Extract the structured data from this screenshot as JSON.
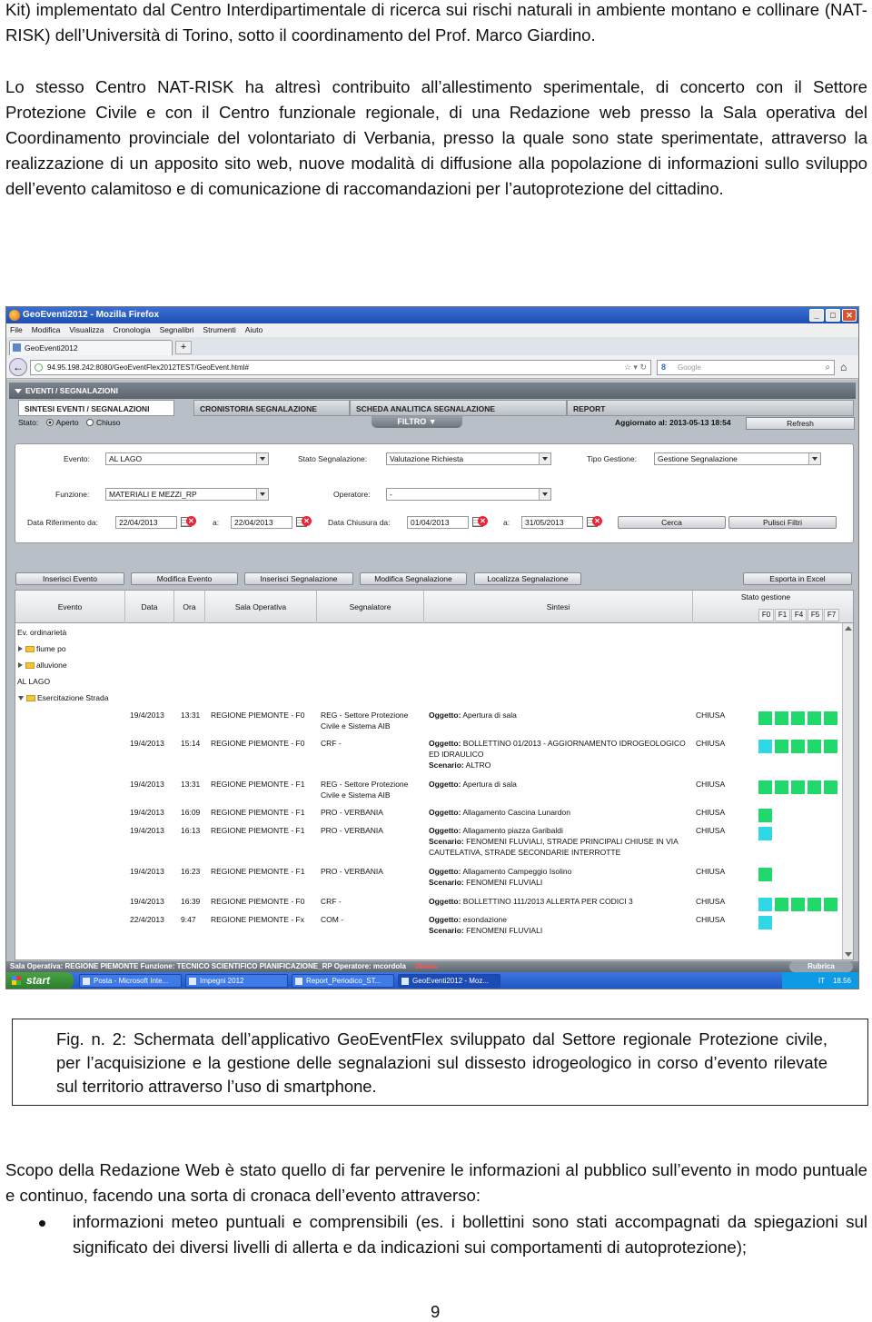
{
  "doc": {
    "para_top": "Kit) implementato dal Centro Interdipartimentale di ricerca sui rischi naturali in ambiente montano e collinare (NAT-RISK) dell’Università di Torino, sotto il coordinamento del Prof. Marco Giardino.",
    "para_2": "Lo stesso Centro NAT-RISK ha altresì contribuito all’allestimento sperimentale, di concerto con il Settore Protezione Civile e con il Centro funzionale regionale, di una Redazione web presso la Sala operativa del Coordinamento provinciale del volontariato di Verbania, presso la quale sono state sperimentate, attraverso la realizzazione di un apposito sito web, nuove modalità di diffusione alla popolazione di informazioni sullo sviluppo dell’evento calamitoso e di comunicazione di raccomandazioni per l’autoprotezione del cittadino.",
    "caption": "Fig. n. 2: Schermata dell’applicativo GeoEventFlex sviluppato dal Settore regionale Protezione civile, per l’acquisizione e la gestione delle segnalazioni sul dissesto idrogeologico in corso d’evento rilevate sul territorio attraverso l’uso di smartphone.",
    "para_3": "Scopo della Redazione Web è stato quello di far pervenire le informazioni al pubblico sull’evento in modo puntuale e continuo, facendo una sorta di cronaca dell’evento attraverso:",
    "bullet_1": "informazioni meteo puntuali e comprensibili (es. i bollettini sono stati accompagnati da spiegazioni sul significato dei diversi livelli di allerta e da indicazioni sui comportamenti di autoprotezione);",
    "page_number": "9"
  },
  "browser": {
    "title": "GeoEventi2012 - Mozilla Firefox",
    "menu": [
      "File",
      "Modifica",
      "Visualizza",
      "Cronologia",
      "Segnalibri",
      "Strumenti",
      "Aiuto"
    ],
    "tab_label": "GeoEventi2012",
    "new_tab": "+",
    "url": "94.95.198.242:8080/GeoEventFlex2012TEST/GeoEvent.html#",
    "search_placeholder": "Google",
    "search_logo": "8"
  },
  "app": {
    "section_title": "EVENTI / SEGNALAZIONI",
    "tabs": [
      "SINTESI EVENTI / SEGNALAZIONI",
      "CRONISTORIA SEGNALAZIONE",
      "SCHEDA ANALITICA SEGNALAZIONE",
      "REPORT"
    ],
    "stato_label": "Stato:",
    "stato_options": [
      "Aperto",
      "Chiuso"
    ],
    "filtro_label": "FILTRO ▼",
    "aggiornato": "Aggiornato al: 2013-05-13 18:54",
    "refresh": "Refresh",
    "filters": {
      "evento_label": "Evento:",
      "evento_value": "AL LAGO",
      "stato_segn_label": "Stato Segnalazione:",
      "stato_segn_value": "Valutazione Richiesta",
      "tipo_gest_label": "Tipo Gestione:",
      "tipo_gest_value": "Gestione Segnalazione",
      "funzione_label": "Funzione:",
      "funzione_value": "MATERIALI E MEZZI_RP",
      "operatore_label": "Operatore:",
      "operatore_value": "-",
      "data_rif_label": "Data Riferimento da:",
      "data_rif_from": "22/04/2013",
      "a_label": "a:",
      "data_rif_to": "22/04/2013",
      "data_chiusura_label": "Data Chiusura da:",
      "data_chiusura_from": "01/04/2013",
      "data_chiusura_to": "31/05/2013",
      "cerca": "Cerca",
      "pulisci": "Pulisci Filtri",
      "x": "✕"
    },
    "actions": [
      "Inserisci Evento",
      "Modifica Evento",
      "Inserisci Segnalazione",
      "Modifica Segnalazione",
      "Localizza Segnalazione",
      "Esporta in Excel"
    ],
    "columns": [
      "Evento",
      "Data",
      "Ora",
      "Sala Operativa",
      "Segnalatore",
      "Sintesi"
    ],
    "stato_gestione": "Stato gestione",
    "f_cols": [
      "F0",
      "F1",
      "F4",
      "F5",
      "F7"
    ],
    "tree": [
      "Ev. ordinarietà",
      "fiume po",
      "alluvione",
      "AL LAGO",
      "Esercitazione Strada"
    ],
    "rows": [
      {
        "data": "19/4/2013",
        "ora": "13:31",
        "sala": "REGIONE PIEMONTE - F0",
        "segn": "REG - Settore Protezione Civile e Sistema AIB",
        "ogg": "Apertura di sala",
        "scen": "",
        "stato": "CHIUSA"
      },
      {
        "data": "19/4/2013",
        "ora": "15:14",
        "sala": "REGIONE PIEMONTE - F0",
        "segn": "CRF -",
        "ogg": "BOLLETTINO 01/2013 - AGGIORNAMENTO IDROGEOLOGICO ED IDRAULICO",
        "scen": "ALTRO",
        "stato": "CHIUSA"
      },
      {
        "data": "19/4/2013",
        "ora": "13:31",
        "sala": "REGIONE PIEMONTE - F1",
        "segn": "REG - Settore Protezione Civile e Sistema AIB",
        "ogg": "Apertura di sala",
        "scen": "",
        "stato": "CHIUSA"
      },
      {
        "data": "19/4/2013",
        "ora": "16:09",
        "sala": "REGIONE PIEMONTE - F1",
        "segn": "PRO - VERBANIA",
        "ogg": "Allagamento Cascina Lunardon",
        "scen": "",
        "stato": "CHIUSA"
      },
      {
        "data": "19/4/2013",
        "ora": "16:13",
        "sala": "REGIONE PIEMONTE - F1",
        "segn": "PRO - VERBANIA",
        "ogg": "Allagamento piazza Garibaldi",
        "scen": "FENOMENI FLUVIALI, STRADE PRINCIPALI CHIUSE IN VIA CAUTELATIVA, STRADE SECONDARIE INTERROTTE",
        "stato": "CHIUSA"
      },
      {
        "data": "19/4/2013",
        "ora": "16:23",
        "sala": "REGIONE PIEMONTE - F1",
        "segn": "PRO - VERBANIA",
        "ogg": "Allagamento Campeggio Isolino",
        "scen": "FENOMENI FLUVIALI",
        "stato": "CHIUSA"
      },
      {
        "data": "19/4/2013",
        "ora": "16:39",
        "sala": "REGIONE PIEMONTE - F0",
        "segn": "CRF -",
        "ogg": "BOLLETTINO 111/2013 ALLERTA PER CODICI 3",
        "scen": "",
        "stato": "CHIUSA"
      },
      {
        "data": "22/4/2013",
        "ora": "9:47",
        "sala": "REGIONE PIEMONTE - Fx",
        "segn": "COM -",
        "ogg": "esondazione",
        "scen": "FENOMENI FLUVIALI",
        "stato": "CHIUSA"
      }
    ],
    "oggetto_prefix": "Oggetto:",
    "scenario_prefix": "Scenario:",
    "statusbar": "Sala Operativa: REGIONE PIEMONTE  Funzione: TECNICO SCIENTIFICO PIANIFICAZIONE_RP  Operatore: mcordola",
    "status_word": "Status",
    "rubrica": "Rubrica"
  },
  "taskbar": {
    "start": "start",
    "tasks": [
      "Posta - Microsoft Inte...",
      "Impegni 2012",
      "Report_Periodico_ST...",
      "GeoEventi2012 - Moz..."
    ],
    "lang": "IT",
    "clock": "18.56"
  }
}
